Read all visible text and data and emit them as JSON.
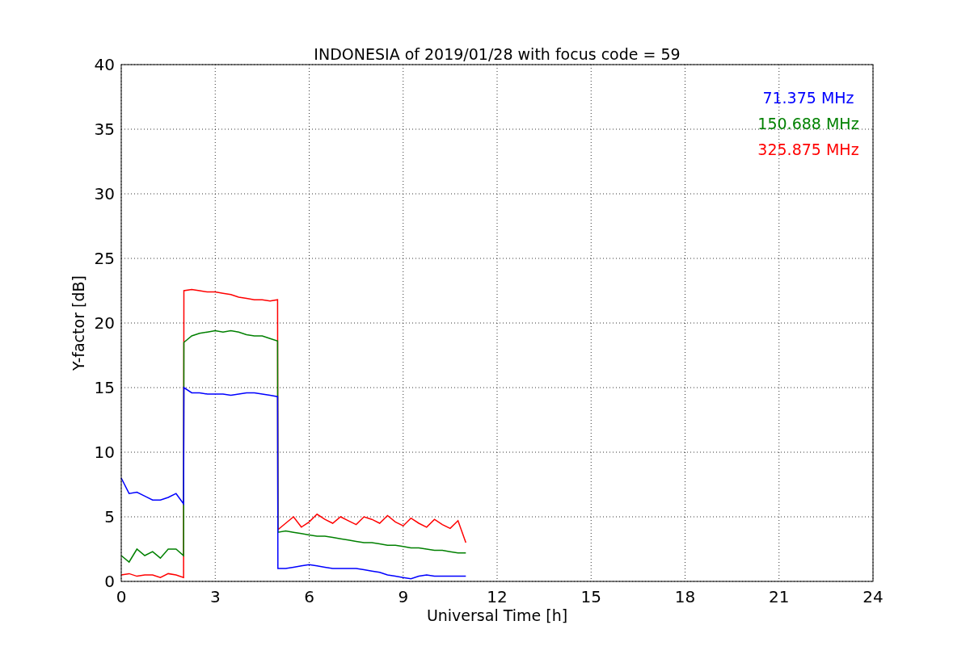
{
  "chart_data": {
    "type": "line",
    "title": "INDONESIA of 2019/01/28 with focus code = 59",
    "xlabel": "Universal Time [h]",
    "ylabel": "Y-factor [dB]",
    "x": [
      0,
      0.25,
      0.5,
      0.75,
      1,
      1.25,
      1.5,
      1.75,
      1.99,
      2,
      2.25,
      2.5,
      2.75,
      3,
      3.25,
      3.5,
      3.75,
      4,
      4.25,
      4.5,
      4.75,
      4.99,
      5,
      5.25,
      5.5,
      5.75,
      6,
      6.25,
      6.5,
      6.75,
      7,
      7.25,
      7.5,
      7.75,
      8,
      8.25,
      8.5,
      8.75,
      9,
      9.25,
      9.5,
      9.75,
      10,
      10.25,
      10.5,
      10.75,
      11
    ],
    "series": [
      {
        "name": "71.375 MHz",
        "color": "#0000ff",
        "values": [
          8,
          6.8,
          6.9,
          6.6,
          6.3,
          6.3,
          6.5,
          6.8,
          6,
          15,
          14.6,
          14.6,
          14.5,
          14.5,
          14.5,
          14.4,
          14.5,
          14.6,
          14.6,
          14.5,
          14.4,
          14.3,
          1,
          1,
          1.1,
          1.2,
          1.3,
          1.2,
          1.1,
          1,
          1,
          1,
          1,
          0.9,
          0.8,
          0.7,
          0.5,
          0.4,
          0.3,
          0.2,
          0.4,
          0.5,
          0.4,
          0.4,
          0.4,
          0.4,
          0.4
        ]
      },
      {
        "name": "150.688 MHz",
        "color": "#008000",
        "values": [
          2,
          1.5,
          2.5,
          2,
          2.3,
          1.8,
          2.5,
          2.5,
          2,
          18.5,
          19,
          19.2,
          19.3,
          19.4,
          19.3,
          19.4,
          19.3,
          19.1,
          19,
          19,
          18.8,
          18.6,
          3.8,
          3.9,
          3.8,
          3.7,
          3.6,
          3.5,
          3.5,
          3.4,
          3.3,
          3.2,
          3.1,
          3,
          3,
          2.9,
          2.8,
          2.8,
          2.7,
          2.6,
          2.6,
          2.5,
          2.4,
          2.4,
          2.3,
          2.2,
          2.2
        ]
      },
      {
        "name": "325.875 MHz",
        "color": "#ff0000",
        "values": [
          0.5,
          0.6,
          0.4,
          0.5,
          0.5,
          0.3,
          0.6,
          0.5,
          0.3,
          22.5,
          22.6,
          22.5,
          22.4,
          22.4,
          22.3,
          22.2,
          22,
          21.9,
          21.8,
          21.8,
          21.7,
          21.8,
          4,
          4.5,
          5,
          4.2,
          4.6,
          5.2,
          4.8,
          4.5,
          5,
          4.7,
          4.4,
          5,
          4.8,
          4.5,
          5.1,
          4.6,
          4.3,
          4.9,
          4.5,
          4.2,
          4.8,
          4.4,
          4.1,
          4.7,
          3
        ]
      }
    ],
    "grid": true,
    "xlim": [
      0,
      24
    ],
    "ylim": [
      0,
      40
    ],
    "xticks": [
      0,
      3,
      6,
      9,
      12,
      15,
      18,
      21,
      24
    ],
    "yticks": [
      0,
      5,
      10,
      15,
      20,
      25,
      30,
      35,
      40
    ]
  }
}
